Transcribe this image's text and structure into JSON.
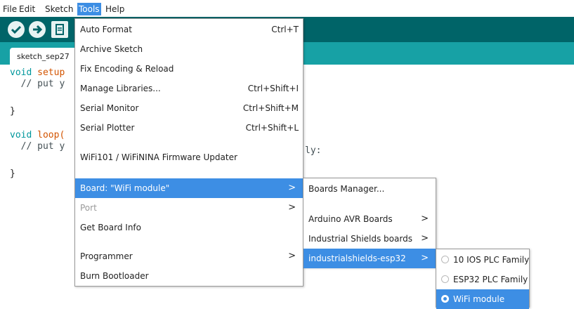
{
  "menubar": {
    "items": [
      {
        "label": "File"
      },
      {
        "label": "Edit"
      },
      {
        "label": "Sketch"
      },
      {
        "label": "Tools"
      },
      {
        "label": "Help"
      }
    ]
  },
  "toolbar": {
    "verify_icon": "check-icon",
    "upload_icon": "arrow-right-icon",
    "new_icon": "document-icon",
    "colors": {
      "toolbar": "#006468",
      "tabbar": "#17a1a5",
      "highlight": "#3d8ee4"
    }
  },
  "tab": {
    "label": "sketch_sep27"
  },
  "code": {
    "l1_kw": "void",
    "l1_fn": "setup",
    "l2": "  // put y",
    "l3": "}",
    "l4_kw": "void",
    "l4_fn": "loop(",
    "l5": "  // put y",
    "l5_tail": "ly:",
    "l6": "}"
  },
  "tools_menu": {
    "items": [
      {
        "label": "Auto Format",
        "shortcut": "Ctrl+T"
      },
      {
        "label": "Archive Sketch"
      },
      {
        "label": "Fix Encoding & Reload"
      },
      {
        "label": "Manage Libraries...",
        "shortcut": "Ctrl+Shift+I"
      },
      {
        "label": "Serial Monitor",
        "shortcut": "Ctrl+Shift+M"
      },
      {
        "label": "Serial Plotter",
        "shortcut": "Ctrl+Shift+L"
      },
      {
        "label": "WiFi101 / WiFiNINA Firmware Updater"
      },
      {
        "label": "Board: \"WiFi module\"",
        "arrow": ">"
      },
      {
        "label": "Port",
        "arrow": ">"
      },
      {
        "label": "Get Board Info"
      },
      {
        "label": "Programmer",
        "arrow": ">"
      },
      {
        "label": "Burn Bootloader"
      }
    ]
  },
  "board_menu": {
    "items": [
      {
        "label": "Boards Manager..."
      },
      {
        "label": "Arduino AVR Boards",
        "arrow": ">"
      },
      {
        "label": "Industrial Shields boards",
        "arrow": ">"
      },
      {
        "label": "industrialshields-esp32",
        "arrow": ">"
      }
    ]
  },
  "esp32_menu": {
    "items": [
      {
        "label": "10 IOS PLC Family",
        "selected": false
      },
      {
        "label": "ESP32 PLC Family",
        "selected": false
      },
      {
        "label": "WiFi module",
        "selected": true
      }
    ]
  }
}
